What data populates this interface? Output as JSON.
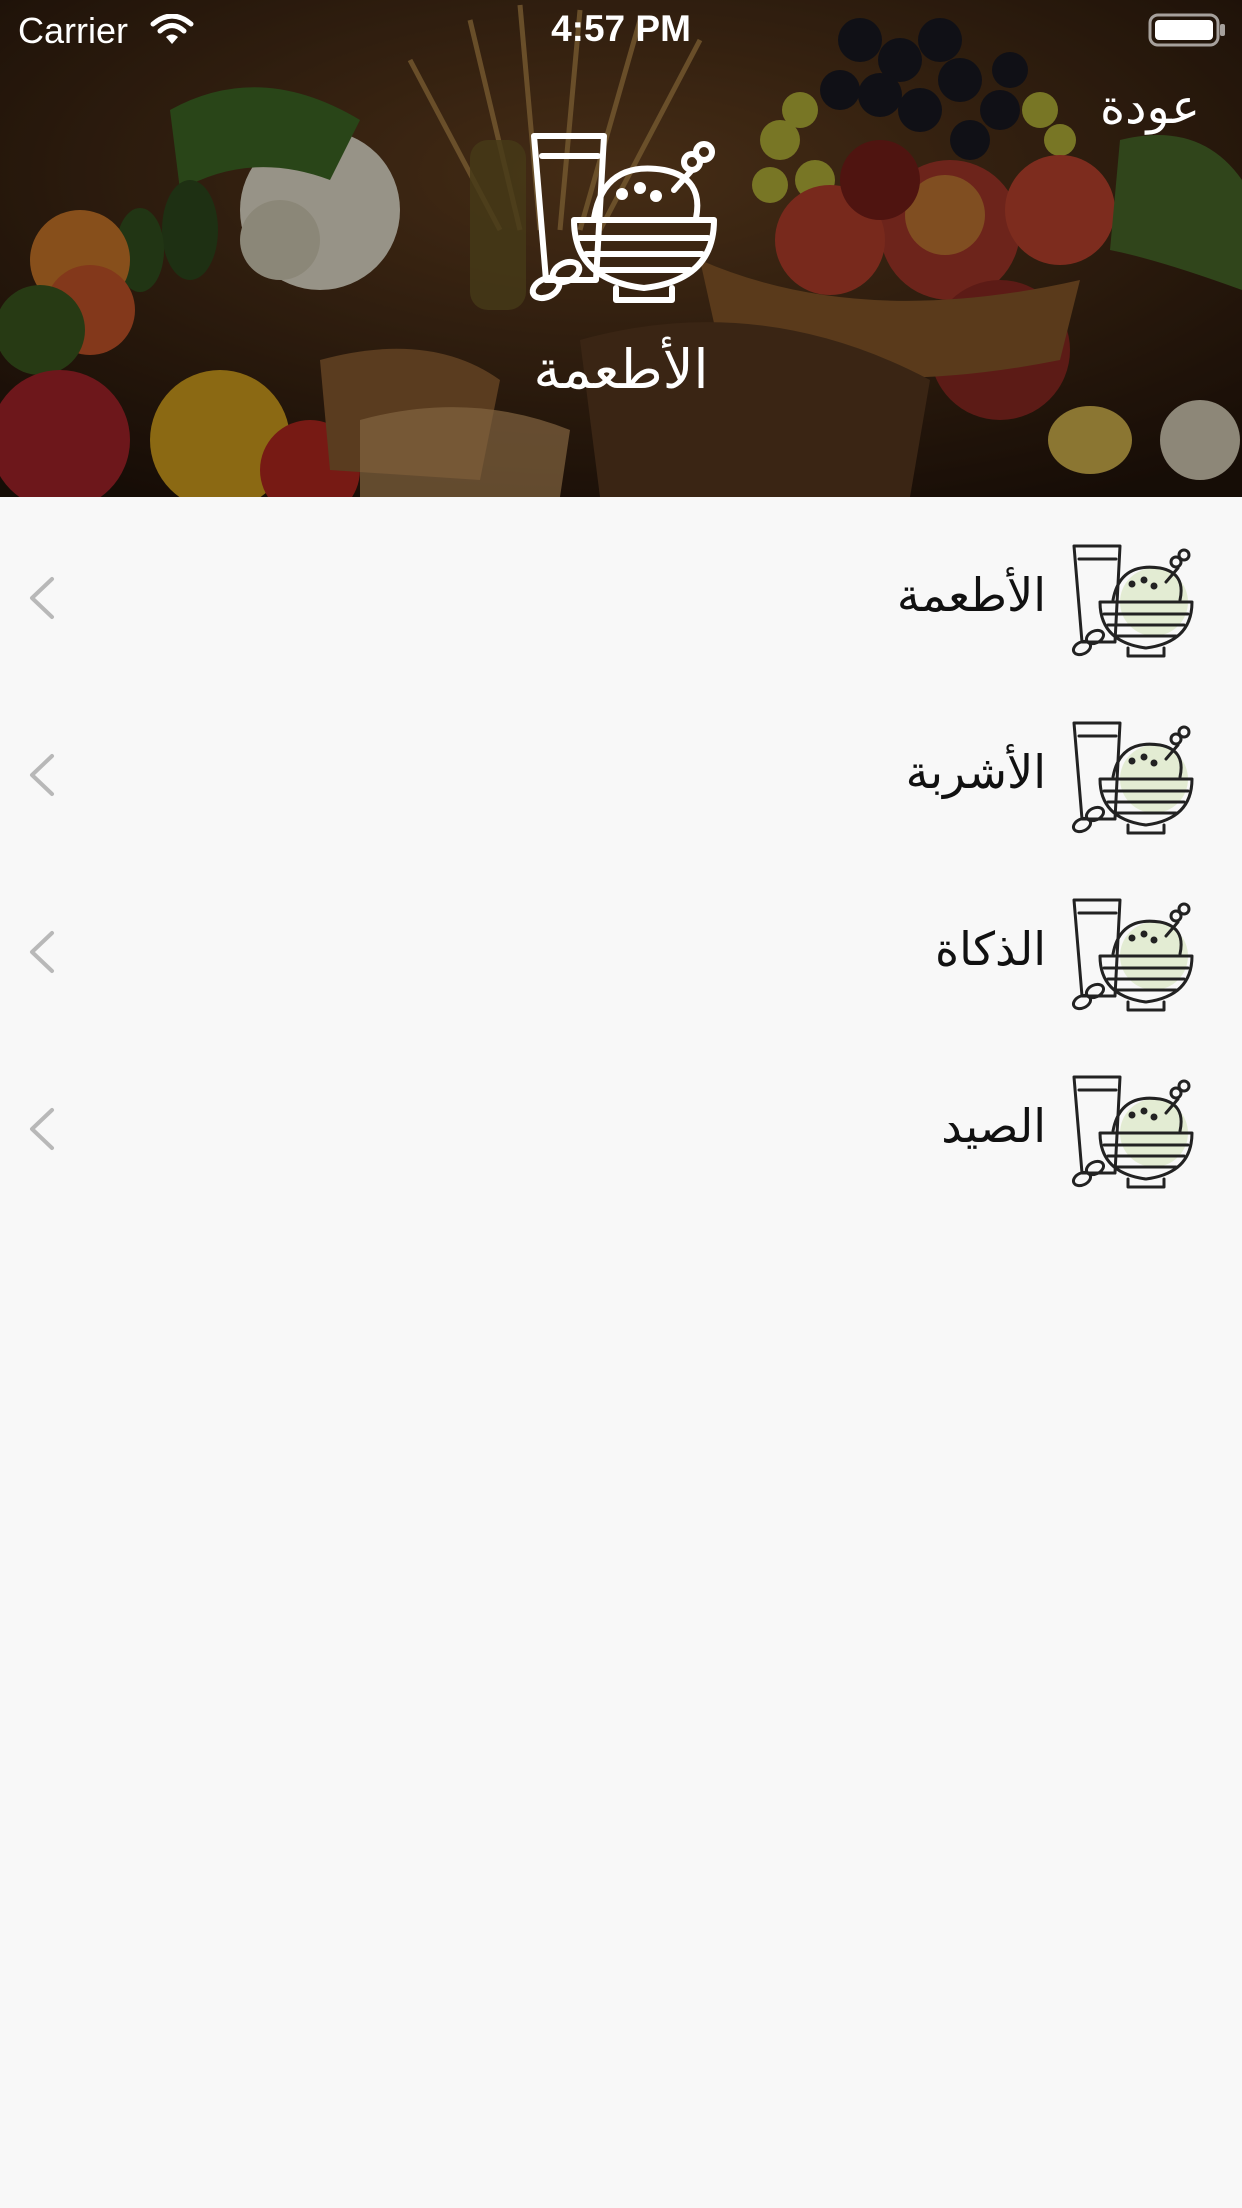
{
  "status_bar": {
    "carrier": "Carrier",
    "time": "4:57 PM"
  },
  "nav": {
    "back_label": "عودة"
  },
  "hero": {
    "title": "الأطعمة",
    "icon": "food-bowl-icon"
  },
  "list": {
    "items": [
      {
        "label": "الأطعمة",
        "icon": "food-bowl-icon"
      },
      {
        "label": "الأشربة",
        "icon": "food-bowl-icon"
      },
      {
        "label": "الذكاة",
        "icon": "food-bowl-icon"
      },
      {
        "label": "الصيد",
        "icon": "food-bowl-icon"
      }
    ]
  },
  "colors": {
    "background": "#f8f8f8",
    "text": "#111111",
    "chevron": "#b8b8b8",
    "icon_accent": "#e3ecd3"
  }
}
